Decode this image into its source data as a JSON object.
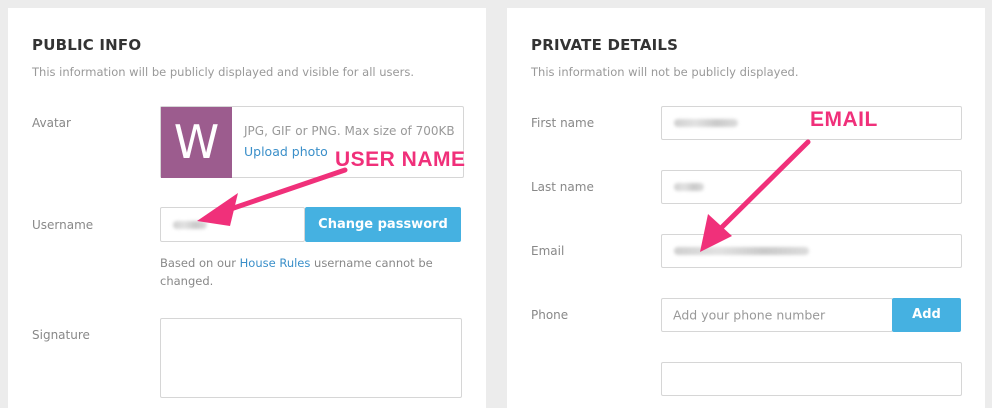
{
  "public": {
    "title": "PUBLIC INFO",
    "subtitle": "This information will be publicly displayed and visible for all users.",
    "avatar": {
      "label": "Avatar",
      "initial": "W",
      "tile_color": "#9c5c8e",
      "hint": "JPG, GIF or PNG. Max size of 700KB",
      "upload_label": "Upload photo"
    },
    "username": {
      "label": "Username",
      "value_obscured": true,
      "change_password_label": "Change password",
      "help_prefix": "Based on our ",
      "help_link": "House Rules",
      "help_suffix": " username cannot be changed."
    },
    "signature": {
      "label": "Signature"
    }
  },
  "private": {
    "title": "PRIVATE DETAILS",
    "subtitle": "This information will not be publicly displayed.",
    "first_name": {
      "label": "First name",
      "value_obscured": true
    },
    "last_name": {
      "label": "Last name",
      "value_obscured": true
    },
    "email": {
      "label": "Email",
      "value_obscured": true
    },
    "phone": {
      "label": "Phone",
      "placeholder": "Add your phone number",
      "add_label": "Add"
    }
  },
  "annotations": {
    "username_note": "USER NAME",
    "email_note": "EMAIL",
    "color": "#f0307a"
  },
  "colors": {
    "accent": "#45b1e1",
    "link": "#3a8fc9",
    "background": "#ececec"
  }
}
